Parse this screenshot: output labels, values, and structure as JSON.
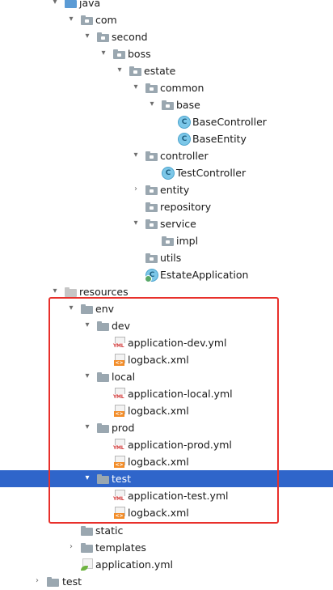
{
  "tree": {
    "java": "java",
    "com": "com",
    "second": "second",
    "boss": "boss",
    "estate": "estate",
    "common": "common",
    "base": "base",
    "base_controller": "BaseController",
    "base_entity": "BaseEntity",
    "controller": "controller",
    "test_controller": "TestController",
    "entity": "entity",
    "repository": "repository",
    "service": "service",
    "impl": "impl",
    "utils": "utils",
    "estate_application": "EstateApplication",
    "resources": "resources",
    "env": "env",
    "dev": "dev",
    "application_dev_yml": "application-dev.yml",
    "logback_xml_dev": "logback.xml",
    "local": "local",
    "application_local_yml": "application-local.yml",
    "logback_xml_local": "logback.xml",
    "prod": "prod",
    "application_prod_yml": "application-prod.yml",
    "logback_xml_prod": "logback.xml",
    "test_folder": "test",
    "application_test_yml": "application-test.yml",
    "logback_xml_test": "logback.xml",
    "static": "static",
    "templates": "templates",
    "application_yml": "application.yml",
    "test_root": "test"
  },
  "icons": {
    "class_letter": "C",
    "yml_tag": "YML",
    "xml_tag": "<>"
  },
  "selected_item": "test",
  "colors": {
    "selection": "#2f65ca",
    "highlight_box": "#e8302b",
    "package_folder": "#9aa7b0",
    "source_folder": "#5b9bd5",
    "class_icon": "#7cc7e8"
  }
}
